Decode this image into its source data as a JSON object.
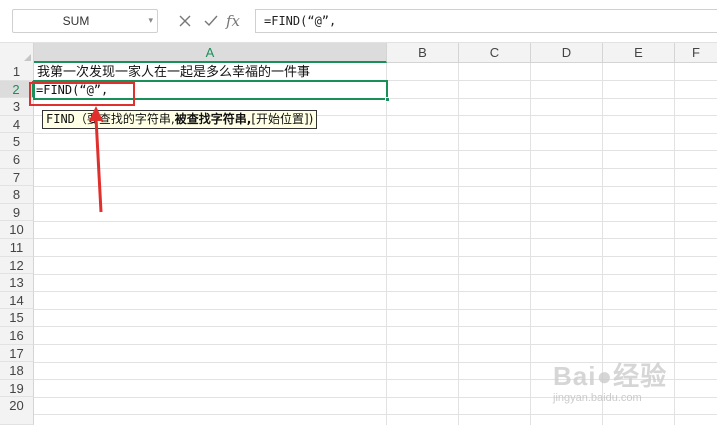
{
  "formula_bar": {
    "name_box_value": "SUM",
    "name_box_arrow_icon": "chevron-down-icon",
    "cancel_icon": "close-icon",
    "confirm_icon": "check-icon",
    "fx_label": "fx",
    "formula_value": "=FIND(“@”,"
  },
  "columns": [
    "A",
    "B",
    "C",
    "D",
    "E",
    "F"
  ],
  "selected_column": "A",
  "rows": [
    "1",
    "2",
    "3",
    "4",
    "5",
    "6",
    "7",
    "8",
    "9",
    "10",
    "11",
    "12",
    "13",
    "14",
    "15",
    "16",
    "17",
    "18",
    "19",
    "20"
  ],
  "selected_row": "2",
  "cells": {
    "A1": "我第一次发现一家人在一起是多么幸福的一件事",
    "A2": "=FIND(“@”,"
  },
  "tooltip": {
    "fn_name": "FIND",
    "open": "（",
    "arg1": "要查找的字符串,",
    "arg2": "被查找字符串,",
    "arg3": "[开始位置])"
  },
  "annotation": {
    "highlight_color": "#e0302e"
  },
  "watermark": {
    "logo_text": "Bai●经验",
    "url": "jingyan.baidu.com"
  },
  "colors": {
    "accent": "#1b8f5a",
    "annotation": "#e0302e",
    "tooltip_bg": "#ffffe6"
  }
}
